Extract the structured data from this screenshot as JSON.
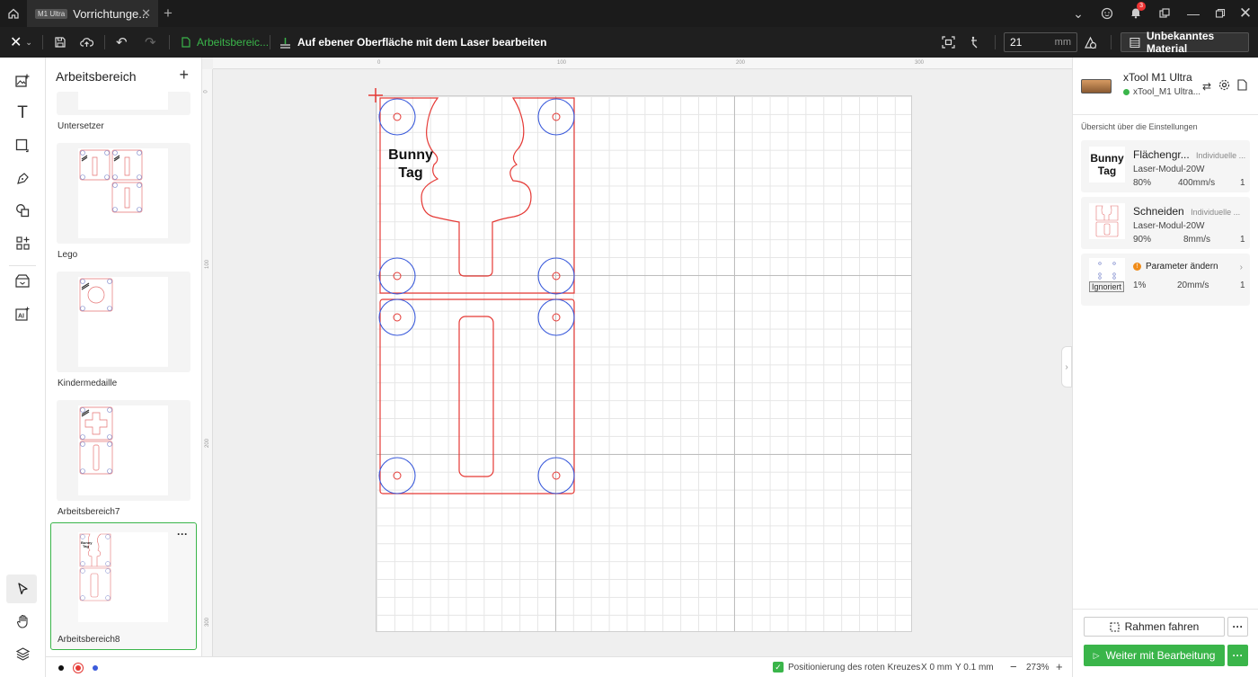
{
  "titlebar": {
    "tab_badge": "M1 Ultra",
    "tab_title": "Vorrichtunge...",
    "notification_count": "3"
  },
  "toolbar": {
    "workspace_label": "Arbeitsbereic...",
    "mode_label": "Auf ebener Oberfläche mit dem Laser bearbeiten",
    "thickness_value": "21",
    "thickness_unit": "mm",
    "material_label": "Unbekanntes Material"
  },
  "panel": {
    "title": "Arbeitsbereich",
    "items": [
      {
        "label": "Untersetzer"
      },
      {
        "label": "Lego"
      },
      {
        "label": "Kindermedaille"
      },
      {
        "label": "Arbeitsbereich7"
      },
      {
        "label": "Arbeitsbereich8"
      }
    ],
    "more": "···"
  },
  "rulers": {
    "top": [
      "0",
      "100",
      "200",
      "300"
    ],
    "left": [
      "0",
      "100",
      "200",
      "300"
    ]
  },
  "canvas": {
    "text_line1": "Bunny",
    "text_line2": "Tag"
  },
  "device": {
    "name": "xTool M1 Ultra",
    "connection": "xTool_M1 Ultra...",
    "status_color": "#3ab54a"
  },
  "settings": {
    "header": "Übersicht über die Einstellungen",
    "items": [
      {
        "title": "Flächengr...",
        "mode": "Individuelle ...",
        "module": "Laser-Modul-20W",
        "power": "80%",
        "speed": "400mm/s",
        "passes": "1",
        "thumb_line1": "Bunny",
        "thumb_line2": "Tag"
      },
      {
        "title": "Schneiden",
        "mode": "Individuelle ...",
        "module": "Laser-Modul-20W",
        "power": "90%",
        "speed": "8mm/s",
        "passes": "1"
      },
      {
        "title": "Parameter ändern",
        "badge": "Ignoriert",
        "power": "1%",
        "speed": "20mm/s",
        "passes": "1"
      }
    ]
  },
  "actions": {
    "frame_label": "Rahmen fahren",
    "continue_label": "Weiter mit Bearbeitung",
    "more": "···"
  },
  "statusbar": {
    "red_cross_label": "Positionierung des roten Kreuzes",
    "x_readout": "X 0 mm",
    "y_readout": "Y 0.1 mm",
    "zoom": "273%",
    "zoom_minus": "−",
    "zoom_plus": "+"
  },
  "colors": {
    "accent": "#3ab54a",
    "cut_red": "#e53935",
    "score_blue": "#3b5bdb"
  }
}
